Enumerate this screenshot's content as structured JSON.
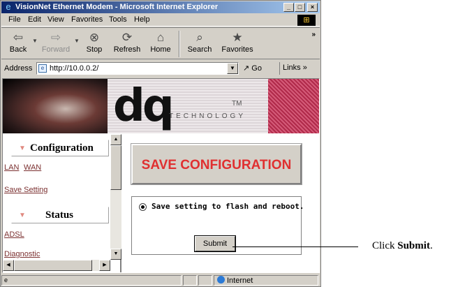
{
  "window": {
    "title": "VisionNet Ethernet Modem - Microsoft Internet Explorer",
    "controls": [
      "_",
      "□",
      "×"
    ]
  },
  "menu": [
    "File",
    "Edit",
    "View",
    "Favorites",
    "Tools",
    "Help"
  ],
  "toolbar": {
    "back": "Back",
    "forward": "Forward",
    "stop": "Stop",
    "refresh": "Refresh",
    "home": "Home",
    "search": "Search",
    "favorites": "Favorites",
    "more": "»"
  },
  "address": {
    "label": "Address",
    "url": "http://10.0.0.2/",
    "go": "Go",
    "links": "Links »"
  },
  "banner": {
    "logo": "dq",
    "technology": "TECHNOLOGY",
    "tm": "TM"
  },
  "nav": {
    "configuration": {
      "title": "Configuration",
      "links": [
        "LAN",
        "WAN",
        "Save Setting"
      ]
    },
    "status": {
      "title": "Status",
      "links": [
        "ADSL",
        "Diagnostic"
      ]
    }
  },
  "main": {
    "heading": "SAVE CONFIGURATION",
    "option_label": "Save setting to flash and reboot.",
    "option_selected": true,
    "submit_label": "Submit"
  },
  "statusbar": {
    "zone": "Internet"
  },
  "annotation": {
    "text_prefix": "Click ",
    "text_bold": "Submit",
    "text_suffix": "."
  },
  "colors": {
    "accent_red": "#e03030",
    "link": "#7b3030",
    "title_bar": "#0a246a"
  }
}
